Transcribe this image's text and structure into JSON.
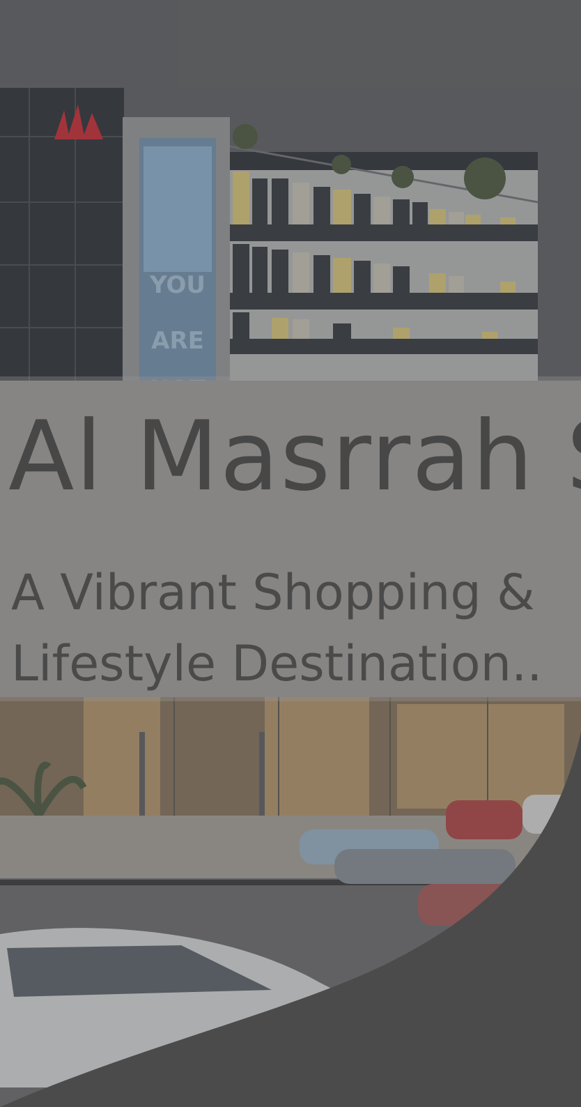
{
  "hero": {
    "title": "Al Masrrah S",
    "subtitle": "A Vibrant Shopping & Lifestyle Destination..",
    "billboard_text": "YOU ARE NOT ALONE"
  },
  "colors": {
    "overlay": "#4b4b4b",
    "title_text": "#474747",
    "building_dark": "#2f3338",
    "window_yellow": "#c9b877",
    "logo_red": "#b8333a"
  }
}
